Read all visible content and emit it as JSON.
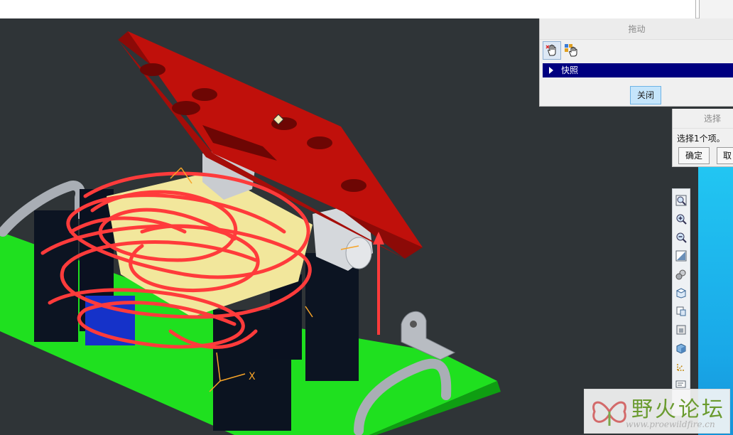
{
  "drag_dialog": {
    "title": "拖动",
    "tools": [
      "hand-pan-icon",
      "hand-snapshot-icon"
    ],
    "snapshot_section": "快照",
    "close_label": "关闭"
  },
  "select_dialog": {
    "title": "选择",
    "message": "选择1个项。",
    "ok_label": "确定",
    "cancel_label": "取"
  },
  "view_toolbar": {
    "icons": [
      "refit-icon",
      "zoom-in-icon",
      "zoom-out-icon",
      "repaint-icon",
      "spin-center-icon",
      "named-views-icon",
      "saved-orientations-icon",
      "display-style-icon",
      "shading-icon",
      "datum-display-icon",
      "annotation-display-icon"
    ]
  },
  "scene": {
    "axis_label": "X"
  },
  "watermark": {
    "title": "野火论坛",
    "url": "www.proewildfire.cn"
  },
  "colors": {
    "viewport_bg": "#2f3437",
    "base_plate": "#1fe01f",
    "top_plate": "#c0100b",
    "part_yellow": "#f2e79c",
    "dialog_bg": "#f0f0f0",
    "highlight_row": "#000080",
    "scribble": "#ff3b3b"
  }
}
